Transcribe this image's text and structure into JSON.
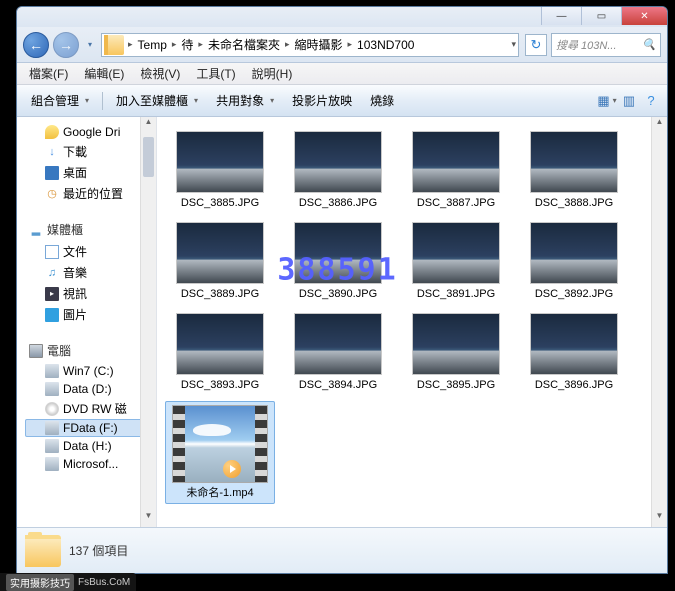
{
  "titlebar": {
    "min": "—",
    "max": "▭",
    "close": "✕"
  },
  "nav": {
    "back": "←",
    "forward": "→",
    "dropdown": "▾"
  },
  "breadcrumb": {
    "segments": [
      "Temp",
      "待",
      "未命名檔案夾",
      "縮時攝影",
      "103ND700"
    ]
  },
  "refresh_icon": "↻",
  "search": {
    "placeholder": "搜尋 103N...",
    "icon": "🔍"
  },
  "menubar": [
    {
      "label": "檔案(F)"
    },
    {
      "label": "編輯(E)"
    },
    {
      "label": "檢視(V)"
    },
    {
      "label": "工具(T)"
    },
    {
      "label": "說明(H)"
    }
  ],
  "toolbar": {
    "organize": "組合管理",
    "include": "加入至媒體櫃",
    "share": "共用對象",
    "slideshow": "投影片放映",
    "burn": "燒錄",
    "icons": {
      "view": "▦",
      "preview": "▥",
      "help": "?"
    }
  },
  "sidebar": {
    "favorites": {
      "items": [
        {
          "icon": "⬤",
          "label": "Google Dri"
        },
        {
          "icon": "↓",
          "label": "下載"
        },
        {
          "icon": "■",
          "label": "桌面"
        },
        {
          "icon": "◷",
          "label": "最近的位置"
        }
      ]
    },
    "libraries": {
      "header": "媒體櫃",
      "items": [
        {
          "icon": "▫",
          "label": "文件"
        },
        {
          "icon": "♫",
          "label": "音樂"
        },
        {
          "icon": "▸",
          "label": "視訊"
        },
        {
          "icon": "▪",
          "label": "圖片"
        }
      ]
    },
    "computer": {
      "header": "電腦",
      "items": [
        {
          "icon": "⛁",
          "label": "Win7 (C:)"
        },
        {
          "icon": "⛁",
          "label": "Data (D:)"
        },
        {
          "icon": "◎",
          "label": "DVD RW 磁"
        },
        {
          "icon": "⛁",
          "label": "FData (F:)",
          "selected": true
        },
        {
          "icon": "⛁",
          "label": "Data (H:)"
        },
        {
          "icon": "⛁",
          "label": "Microsof..."
        }
      ]
    }
  },
  "files": [
    {
      "type": "img",
      "name": "DSC_3885.JPG"
    },
    {
      "type": "img",
      "name": "DSC_3886.JPG"
    },
    {
      "type": "img",
      "name": "DSC_3887.JPG"
    },
    {
      "type": "img",
      "name": "DSC_3888.JPG"
    },
    {
      "type": "img",
      "name": "DSC_3889.JPG"
    },
    {
      "type": "img",
      "name": "DSC_3890.JPG"
    },
    {
      "type": "img",
      "name": "DSC_3891.JPG"
    },
    {
      "type": "img",
      "name": "DSC_3892.JPG"
    },
    {
      "type": "img",
      "name": "DSC_3893.JPG"
    },
    {
      "type": "img",
      "name": "DSC_3894.JPG"
    },
    {
      "type": "img",
      "name": "DSC_3895.JPG"
    },
    {
      "type": "img",
      "name": "DSC_3896.JPG"
    },
    {
      "type": "video",
      "name": "未命名-1.mp4",
      "selected": true
    }
  ],
  "watermark": "388591",
  "status": {
    "count": "137 個項目"
  },
  "footer": {
    "badge": "实用摄影技巧",
    "site": "FsBus.CoM"
  }
}
